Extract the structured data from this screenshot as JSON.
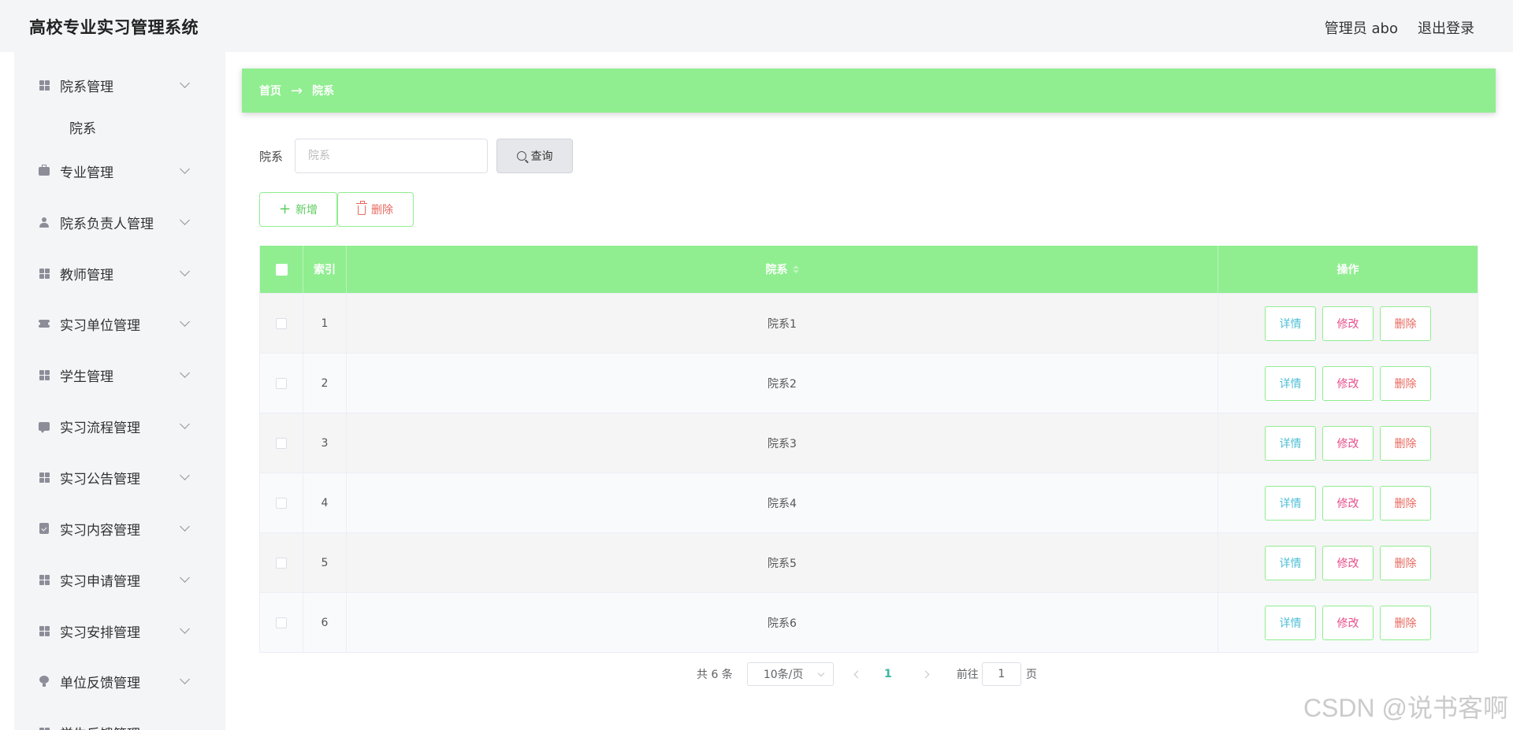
{
  "header": {
    "app_title": "高校专业实习管理系统",
    "user": "管理员 abo",
    "logout": "退出登录"
  },
  "sidebar": {
    "items": [
      {
        "label": "院系管理",
        "icon": "grid-icon"
      },
      {
        "label": "专业管理",
        "icon": "briefcase-icon"
      },
      {
        "label": "院系负责人管理",
        "icon": "user-icon"
      },
      {
        "label": "教师管理",
        "icon": "grid-icon"
      },
      {
        "label": "实习单位管理",
        "icon": "ticket-icon"
      },
      {
        "label": "学生管理",
        "icon": "grid-icon"
      },
      {
        "label": "实习流程管理",
        "icon": "chat-icon"
      },
      {
        "label": "实习公告管理",
        "icon": "grid-icon"
      },
      {
        "label": "实习内容管理",
        "icon": "clipboard-icon"
      },
      {
        "label": "实习申请管理",
        "icon": "grid-icon"
      },
      {
        "label": "实习安排管理",
        "icon": "grid-icon"
      },
      {
        "label": "单位反馈管理",
        "icon": "bulb-icon"
      },
      {
        "label": "学生反馈管理",
        "icon": "grid-icon"
      }
    ],
    "submenu": [
      "院系"
    ]
  },
  "breadcrumb": {
    "home": "首页",
    "separator": "→",
    "current": "院系"
  },
  "search": {
    "label": "院系",
    "placeholder": "院系",
    "value": "",
    "button": "查询"
  },
  "toolbar": {
    "add": "新增",
    "delete": "删除"
  },
  "table": {
    "columns": [
      "索引",
      "院系",
      "操作"
    ],
    "rows": [
      {
        "index": "1",
        "name": "院系1"
      },
      {
        "index": "2",
        "name": "院系2"
      },
      {
        "index": "3",
        "name": "院系3"
      },
      {
        "index": "4",
        "name": "院系4"
      },
      {
        "index": "5",
        "name": "院系5"
      },
      {
        "index": "6",
        "name": "院系6"
      }
    ],
    "actions": {
      "detail": "详情",
      "edit": "修改",
      "delete": "删除"
    }
  },
  "pagination": {
    "total": "共 6 条",
    "page_size": "10条/页",
    "current": "1",
    "goto_prefix": "前往",
    "goto_value": "1",
    "goto_suffix": "页"
  },
  "watermark": "CSDN @说书客啊",
  "colors": {
    "accent": "#90ee90",
    "sidebar_bg": "#f4f5f7",
    "detail": "#4fbfd6",
    "edit": "#e64e8c",
    "delete": "#e8685e"
  }
}
